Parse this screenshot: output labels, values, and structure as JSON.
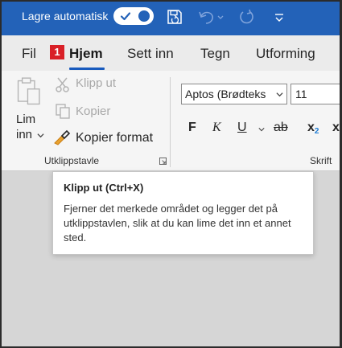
{
  "titlebar": {
    "autosave_label": "Lagre automatisk",
    "autosave_on": true,
    "icons": [
      "save-icon",
      "undo-icon",
      "redo-icon",
      "customize-quick-access-icon"
    ]
  },
  "menu": {
    "tabs": [
      {
        "label": "Fil",
        "active": false
      },
      {
        "label": "Hjem",
        "active": true
      },
      {
        "label": "Sett inn",
        "active": false
      },
      {
        "label": "Tegn",
        "active": false
      },
      {
        "label": "Utforming",
        "active": false
      }
    ],
    "badge": "1"
  },
  "clipboard": {
    "paste_line1": "Lim",
    "paste_line2": "inn",
    "cut_label": "Klipp ut",
    "copy_label": "Kopier",
    "format_painter_label": "Kopier format",
    "group_label": "Utklippstavle"
  },
  "font": {
    "font_name": "Aptos (Brødteks",
    "font_size": "11",
    "bold": "F",
    "italic": "K",
    "underline": "U",
    "strikethrough": "ab",
    "subscript": "x",
    "subscript_sub": "2",
    "superscript": "x",
    "group_label": "Skrift"
  },
  "tooltip": {
    "title": "Klipp ut (Ctrl+X)",
    "body": "Fjerner det merkede området og legger det på utklippstavlen, slik at du kan lime det inn et annet sted."
  },
  "colors": {
    "titlebar": "#2362b8",
    "accent": "#185abd",
    "badge": "#d92027",
    "format_painter_orange": "#e8a230"
  }
}
